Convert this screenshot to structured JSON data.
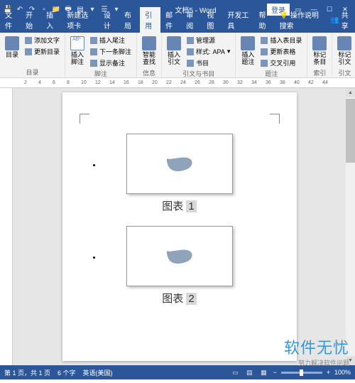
{
  "window": {
    "title": "文档5 - Word",
    "login": "登录"
  },
  "tabs": {
    "file": "文件",
    "home": "开始",
    "insert": "插入",
    "newtab": "新建选项卡",
    "design": "设计",
    "layout": "布局",
    "references": "引用",
    "mail": "邮件",
    "review": "审阅",
    "view": "视图",
    "dev": "开发工具",
    "help": "帮助",
    "tellme": "操作说明搜索"
  },
  "ribbon": {
    "toc": {
      "main": "目录",
      "add_text": "添加文字",
      "update": "更新目录",
      "label": "目录"
    },
    "footnote": {
      "insert": "插入脚注",
      "endnote": "插入尾注",
      "next": "下一条脚注",
      "show": "显示备注",
      "label": "脚注"
    },
    "lookup": {
      "smart": "智能\n查找",
      "label": "信息检索"
    },
    "citation": {
      "insert": "插入引文",
      "manage": "管理源",
      "style": "样式:",
      "style_val": "APA",
      "biblio": "书目",
      "label": "引文与书目"
    },
    "caption": {
      "insert": "插入题注",
      "tof": "插入表目录",
      "update_tof": "更新表格",
      "xref": "交叉引用",
      "label": "题注"
    },
    "index": {
      "mark": "标记\n条目",
      "label": "索引"
    },
    "toa": {
      "mark": "标记引文",
      "label": "引文目录"
    }
  },
  "ruler": {
    "marks": [
      "2",
      "4",
      "6",
      "8",
      "10",
      "12",
      "14",
      "16",
      "18",
      "20",
      "22",
      "24",
      "26",
      "28",
      "30",
      "32",
      "34",
      "36",
      "38",
      "40",
      "42",
      "44"
    ]
  },
  "document": {
    "captions": [
      {
        "prefix": "图表 ",
        "num": "1"
      },
      {
        "prefix": "图表 ",
        "num": "2"
      }
    ]
  },
  "status": {
    "page": "第 1 页，共 1 页",
    "words": "6 个字",
    "lang": "英语(美国)",
    "zoom": "100%"
  },
  "share": "共享",
  "watermark": {
    "main": "软件无忧",
    "sub": "努力解决软件问题"
  }
}
